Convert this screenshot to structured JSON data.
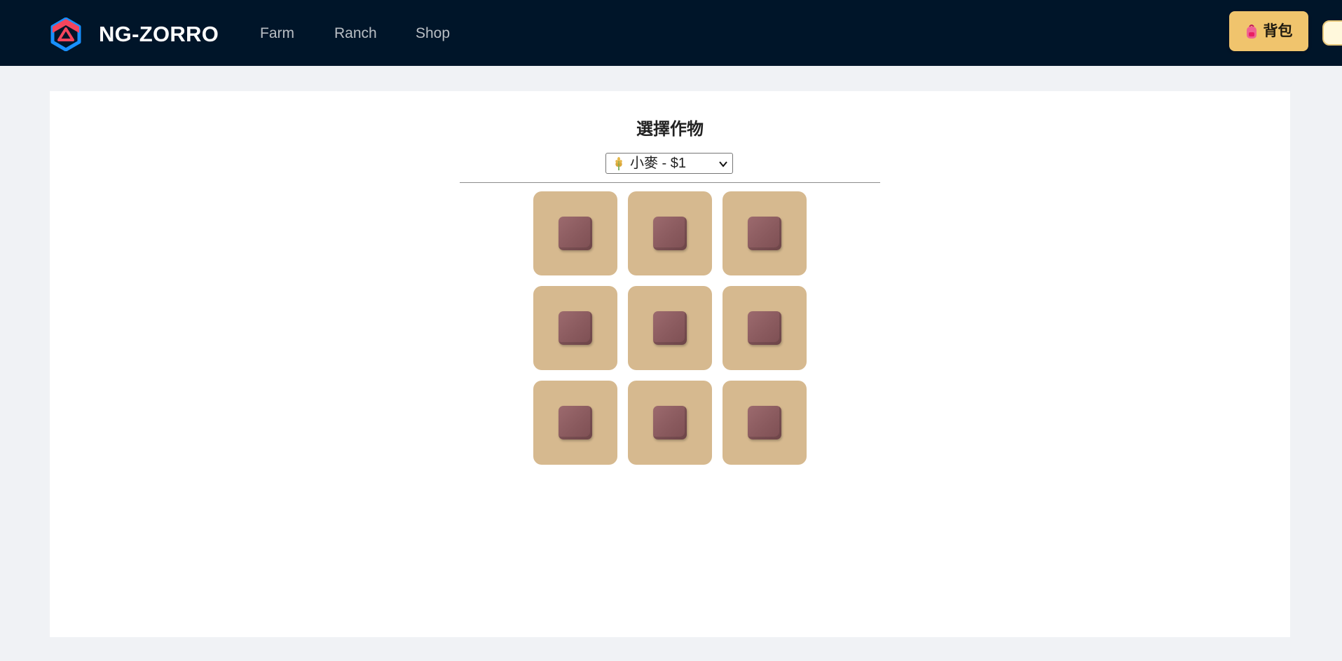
{
  "header": {
    "brand": "NG-ZORRO",
    "nav": [
      {
        "label": "Farm"
      },
      {
        "label": "Ranch"
      },
      {
        "label": "Shop"
      }
    ],
    "backpack_label": "背包",
    "colors": {
      "background": "#001529",
      "backpack_button": "#f0c46d"
    }
  },
  "main": {
    "title": "選擇作物",
    "crop_select": {
      "selected": "小麥 - $1",
      "icon": "wheat-icon"
    },
    "plots": [
      {
        "state": "empty"
      },
      {
        "state": "empty"
      },
      {
        "state": "empty"
      },
      {
        "state": "empty"
      },
      {
        "state": "empty"
      },
      {
        "state": "empty"
      },
      {
        "state": "empty"
      },
      {
        "state": "empty"
      },
      {
        "state": "empty"
      }
    ],
    "colors": {
      "plot": "#d6b98f",
      "soil": "#8a5a5e"
    }
  }
}
